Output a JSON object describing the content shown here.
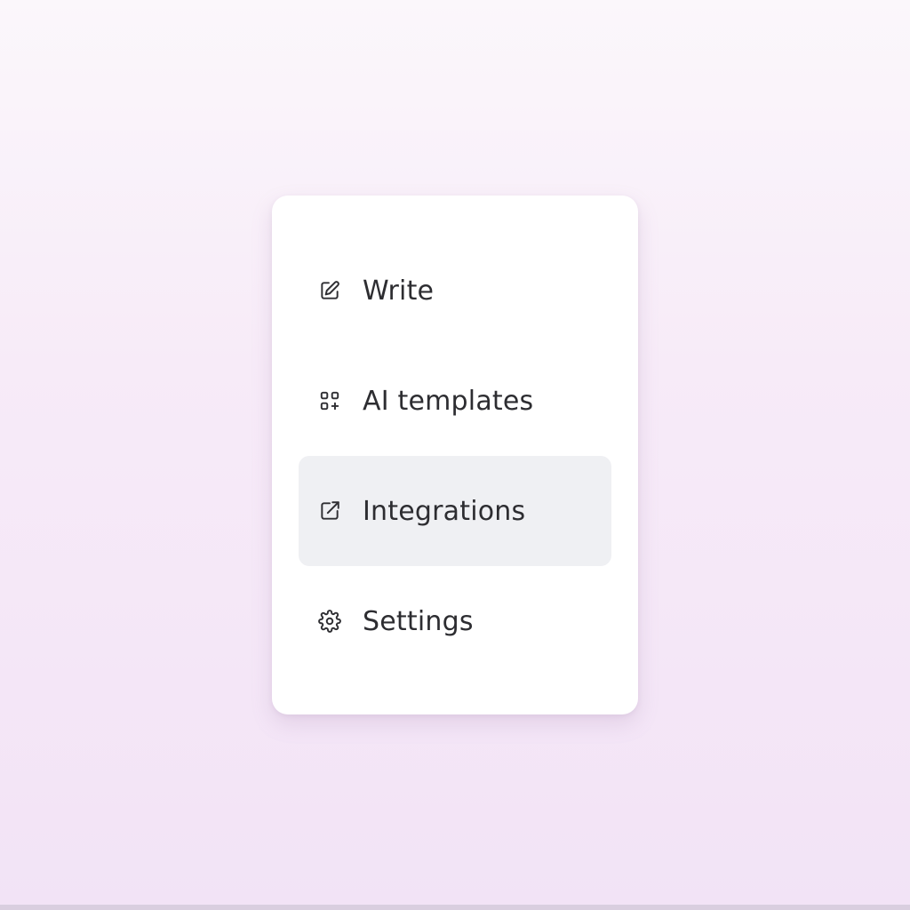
{
  "menu": {
    "items": [
      {
        "label": "Write",
        "icon": "edit-square-icon",
        "active": false
      },
      {
        "label": "AI templates",
        "icon": "grid-templates-icon",
        "active": false
      },
      {
        "label": "Integrations",
        "icon": "external-link-icon",
        "active": true
      },
      {
        "label": "Settings",
        "icon": "gear-icon",
        "active": false
      }
    ]
  },
  "colors": {
    "card_background": "#ffffff",
    "active_item_background": "#eff0f3",
    "text": "#2d2d31",
    "page_gradient_top": "#fbf7fb",
    "page_gradient_bottom": "#f2e3f6"
  }
}
